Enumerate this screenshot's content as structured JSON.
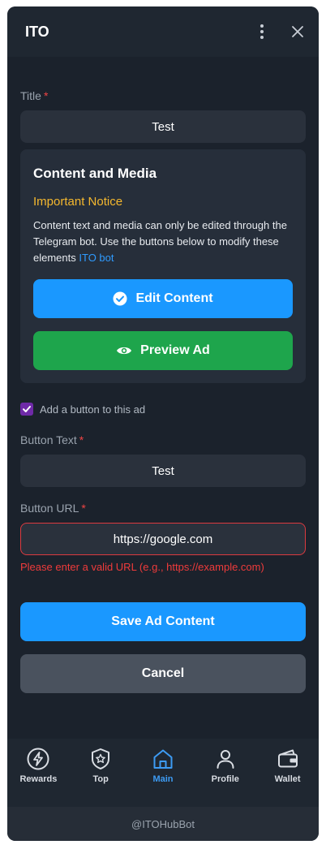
{
  "header": {
    "title": "ITO"
  },
  "form": {
    "title_label": "Title",
    "required_mark": "*",
    "title_value": "Test",
    "checkbox_label": "Add a button to this ad",
    "checkbox_checked": true,
    "button_text_label": "Button Text",
    "button_text_value": "Test",
    "button_url_label": "Button URL",
    "button_url_value": "https://google.com",
    "url_error": "Please enter a valid URL (e.g., https://example.com)",
    "save_label": "Save Ad Content",
    "cancel_label": "Cancel"
  },
  "card": {
    "title": "Content and Media",
    "notice_heading": "Important Notice",
    "notice_text": "Content text and media can only be edited through the Telegram bot. Use the buttons below to modify these elements ",
    "notice_link": "ITO bot",
    "edit_label": "Edit Content",
    "preview_label": "Preview Ad"
  },
  "nav": {
    "items": [
      {
        "label": "Rewards",
        "icon": "lightning-icon"
      },
      {
        "label": "Top",
        "icon": "star-shield-icon"
      },
      {
        "label": "Main",
        "icon": "home-icon",
        "active": true
      },
      {
        "label": "Profile",
        "icon": "user-icon"
      },
      {
        "label": "Wallet",
        "icon": "wallet-icon"
      }
    ]
  },
  "footer": {
    "handle": "@ITOHubBot"
  },
  "colors": {
    "accent_blue": "#1a98ff",
    "preview_green": "#1ea54c",
    "cancel_gray": "#4a525e",
    "error_red": "#ef3b3b",
    "notice_yellow": "#f5b82e",
    "active_nav": "#3d9bf3"
  }
}
